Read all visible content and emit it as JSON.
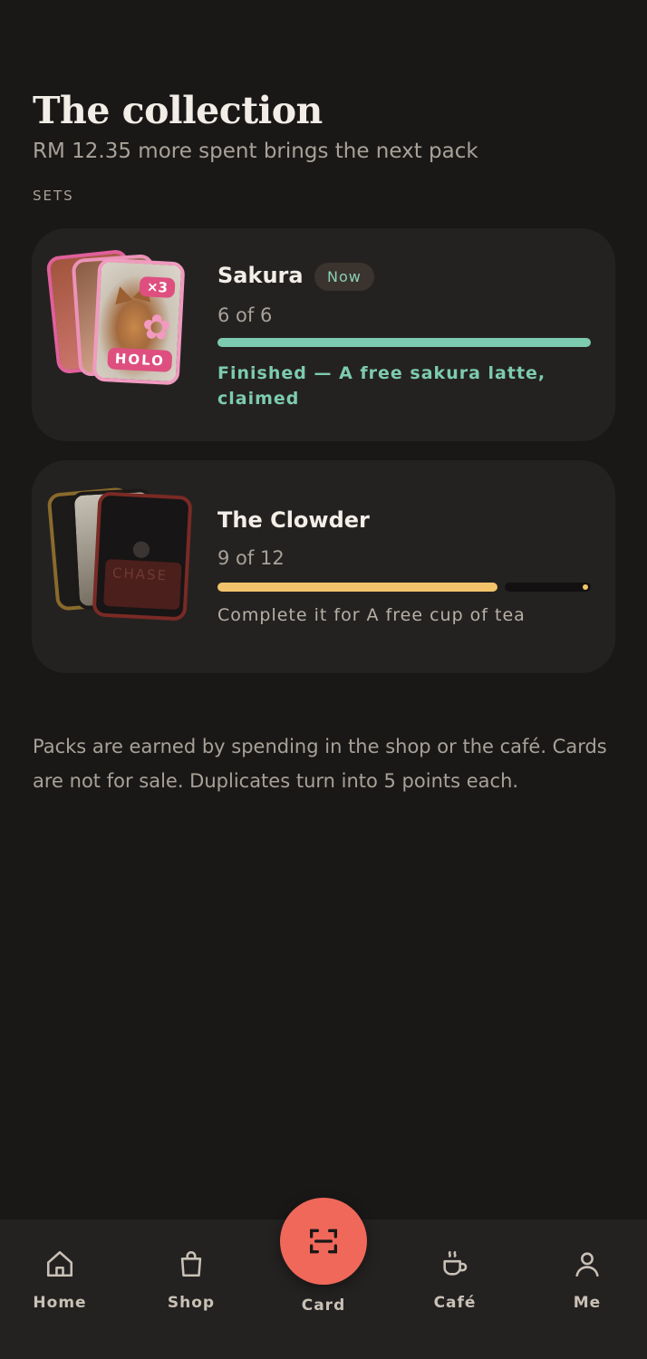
{
  "header": {
    "title": "The collection",
    "subtitle": "RM 12.35 more spent brings the next pack",
    "section_label": "SETS"
  },
  "sets": [
    {
      "name": "Sakura",
      "badge": "Now",
      "count": "6 of 6",
      "progress": 1.0,
      "status": "Finished — A free sakura latte, claimed",
      "card_labels": {
        "duplicates": "×3",
        "rarity": "HOLO"
      },
      "colors": {
        "progress": "#7dcbb0",
        "frame": "#e0609a"
      }
    },
    {
      "name": "The Clowder",
      "count": "9 of 12",
      "progress": 0.75,
      "status": "Complete it for A free cup of tea",
      "card_labels": {
        "rarity": "CHASE"
      },
      "colors": {
        "progress": "#f2c36a",
        "frame": "#7a2a25"
      }
    }
  ],
  "footnote": "Packs are earned by spending in the shop or the café. Cards are not for sale. Duplicates turn into 5 points each.",
  "bottom_nav": {
    "items": [
      {
        "label": "Home",
        "icon": "home-icon"
      },
      {
        "label": "Shop",
        "icon": "shopping-bag-icon"
      },
      {
        "label": "Card",
        "icon": "scan-icon",
        "primary": true
      },
      {
        "label": "Café",
        "icon": "coffee-cup-icon"
      },
      {
        "label": "Me",
        "icon": "user-icon"
      }
    ]
  },
  "colors": {
    "background": "#1a1817",
    "surface": "#242221",
    "accent": "#f0685a",
    "complete": "#7dcbb0",
    "in_progress": "#f2c36a"
  }
}
